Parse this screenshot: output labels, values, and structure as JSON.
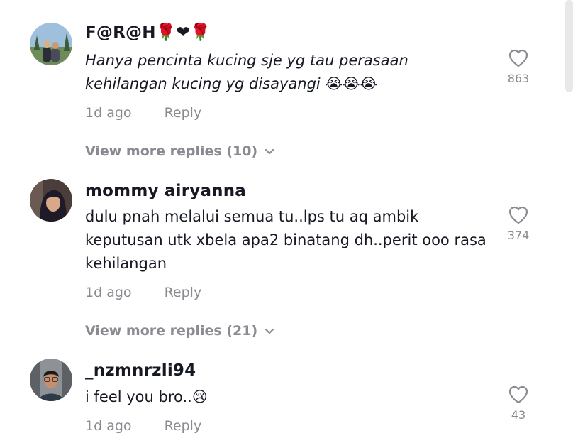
{
  "comments": [
    {
      "username": "F@R@H🌹❤🌹",
      "text": "Hanya pencinta kucing sje yg tau perasaan kehilangan kucing yg disayangi 😭😭😭",
      "time": "1d ago",
      "reply_label": "Reply",
      "likes": "863",
      "view_more": "View more replies (10)"
    },
    {
      "username": "mommy airyanna",
      "text": "dulu pnah melalui semua tu..lps tu aq ambik keputusan utk xbela apa2 binatang dh..perit ooo rasa kehilangan",
      "time": "1d ago",
      "reply_label": "Reply",
      "likes": "374",
      "view_more": "View more replies (21)"
    },
    {
      "username": "_nzmnrzli94",
      "text": "i feel you bro..😢",
      "time": "1d ago",
      "reply_label": "Reply",
      "likes": "43"
    }
  ],
  "icons": {
    "like": "heart-outline-icon",
    "expand": "chevron-down-icon"
  },
  "colors": {
    "primary_text": "#161823",
    "secondary_text": "#8a8b91"
  }
}
